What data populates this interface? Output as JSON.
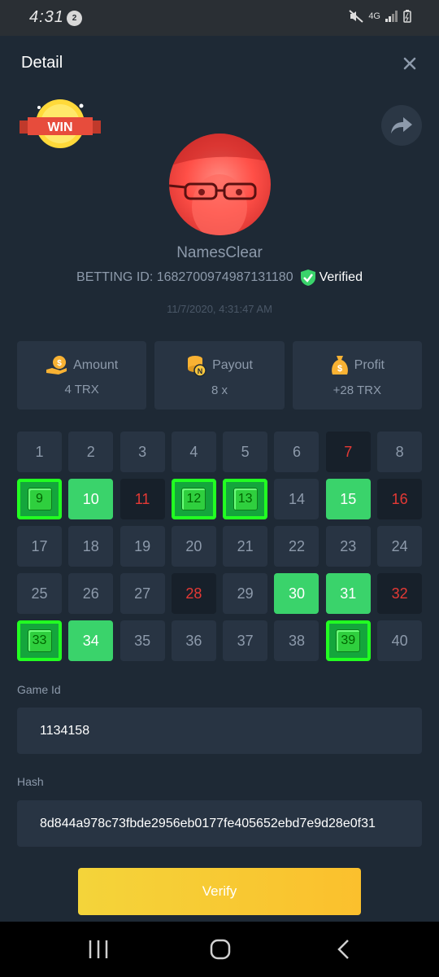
{
  "status_bar": {
    "time": "4:31",
    "notification_count": "2",
    "network": "4G"
  },
  "header": {
    "title": "Detail"
  },
  "badge": {
    "text": "WIN"
  },
  "user": {
    "name": "NamesClear",
    "betting_id_label": "BETTING ID: 1682700974987131180",
    "verified_label": "Verified",
    "timestamp": "11/7/2020, 4:31:47 AM"
  },
  "stats": [
    {
      "label": "Amount",
      "value": "4 TRX",
      "icon": "money-hand-icon"
    },
    {
      "label": "Payout",
      "value": "8 x",
      "icon": "coin-stack-icon"
    },
    {
      "label": "Profit",
      "value": "+28 TRX",
      "icon": "money-bag-icon"
    }
  ],
  "grid": [
    {
      "n": "1",
      "s": "normal"
    },
    {
      "n": "2",
      "s": "normal"
    },
    {
      "n": "3",
      "s": "normal"
    },
    {
      "n": "4",
      "s": "normal"
    },
    {
      "n": "5",
      "s": "normal"
    },
    {
      "n": "6",
      "s": "normal"
    },
    {
      "n": "7",
      "s": "dark"
    },
    {
      "n": "8",
      "s": "normal"
    },
    {
      "n": "9",
      "s": "boxed"
    },
    {
      "n": "10",
      "s": "green"
    },
    {
      "n": "11",
      "s": "dark"
    },
    {
      "n": "12",
      "s": "boxed"
    },
    {
      "n": "13",
      "s": "boxed"
    },
    {
      "n": "14",
      "s": "normal"
    },
    {
      "n": "15",
      "s": "green"
    },
    {
      "n": "16",
      "s": "dark"
    },
    {
      "n": "17",
      "s": "normal"
    },
    {
      "n": "18",
      "s": "normal"
    },
    {
      "n": "19",
      "s": "normal"
    },
    {
      "n": "20",
      "s": "normal"
    },
    {
      "n": "21",
      "s": "normal"
    },
    {
      "n": "22",
      "s": "normal"
    },
    {
      "n": "23",
      "s": "normal"
    },
    {
      "n": "24",
      "s": "normal"
    },
    {
      "n": "25",
      "s": "normal"
    },
    {
      "n": "26",
      "s": "normal"
    },
    {
      "n": "27",
      "s": "normal"
    },
    {
      "n": "28",
      "s": "dark"
    },
    {
      "n": "29",
      "s": "normal"
    },
    {
      "n": "30",
      "s": "green"
    },
    {
      "n": "31",
      "s": "green"
    },
    {
      "n": "32",
      "s": "dark"
    },
    {
      "n": "33",
      "s": "boxed"
    },
    {
      "n": "34",
      "s": "green"
    },
    {
      "n": "35",
      "s": "normal"
    },
    {
      "n": "36",
      "s": "normal"
    },
    {
      "n": "37",
      "s": "normal"
    },
    {
      "n": "38",
      "s": "normal"
    },
    {
      "n": "39",
      "s": "boxed"
    },
    {
      "n": "40",
      "s": "normal"
    }
  ],
  "game": {
    "label": "Game Id",
    "value": "1134158"
  },
  "hash": {
    "label": "Hash",
    "value": "8d844a978c73fbde2956eb0177fe405652ebd7e9d28e0f31"
  },
  "verify_label": "Verify",
  "colors": {
    "accent_green": "#3ad36b",
    "lose_red": "#e53935",
    "verify_yellow": "#f4d43a",
    "background": "#1e2935"
  }
}
